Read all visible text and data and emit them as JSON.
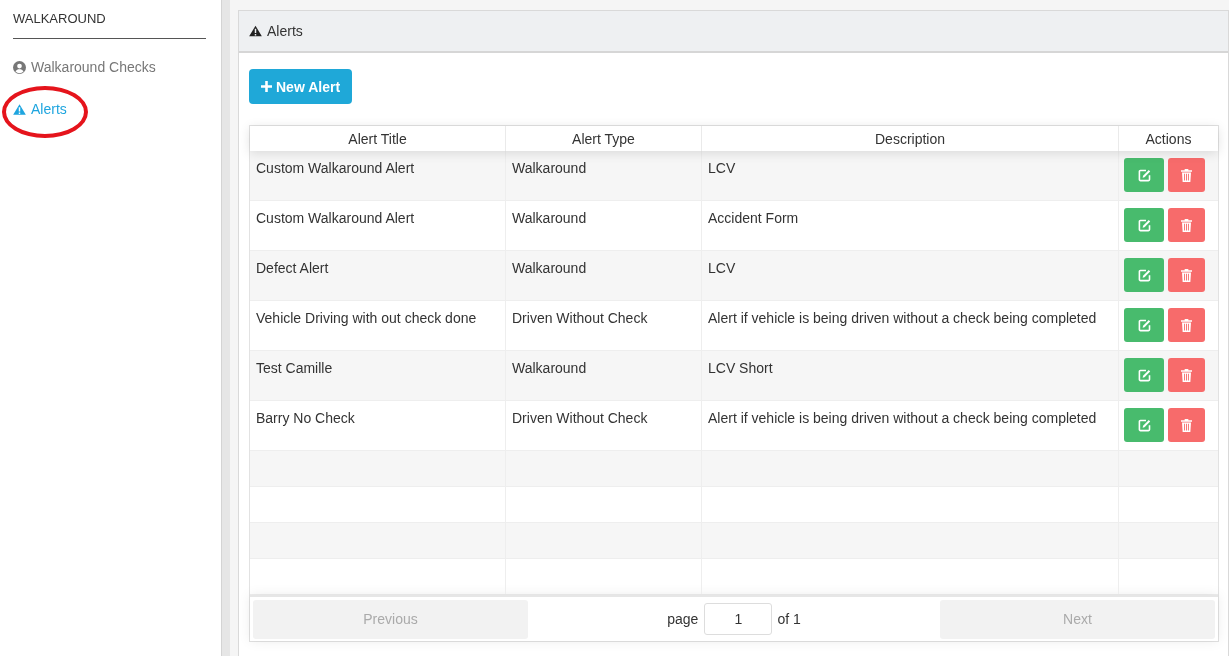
{
  "sidebar": {
    "heading": "WALKAROUND",
    "items": [
      {
        "kind": "checks",
        "label": "Walkaround Checks",
        "selected": false,
        "circled": false
      },
      {
        "kind": "alerts",
        "label": "Alerts",
        "selected": true,
        "circled": true
      }
    ]
  },
  "panel": {
    "title": "Alerts",
    "new_button": {
      "label": "New Alert"
    }
  },
  "table": {
    "columns": [
      "Alert Title",
      "Alert Type",
      "Description",
      "Actions"
    ],
    "rows": [
      [
        "Custom Walkaround Alert",
        "Walkaround",
        "LCV"
      ],
      [
        "Custom Walkaround Alert",
        "Walkaround",
        "Accident Form"
      ],
      [
        "Defect Alert",
        "Walkaround",
        "LCV"
      ],
      [
        "Vehicle Driving with out check done",
        "Driven Without Check",
        "Alert if vehicle is being driven without a check being completed"
      ],
      [
        "Test Camille",
        "Walkaround",
        "LCV Short"
      ],
      [
        "Barry No Check",
        "Driven Without Check",
        "Alert if vehicle is being driven without a check being completed"
      ]
    ]
  },
  "pagination": {
    "previous": {
      "label": "Previous",
      "disabled": true
    },
    "page_label": "page",
    "page_value": "1",
    "of_label": "of 1",
    "next": {
      "label": "Next",
      "disabled": true
    }
  }
}
